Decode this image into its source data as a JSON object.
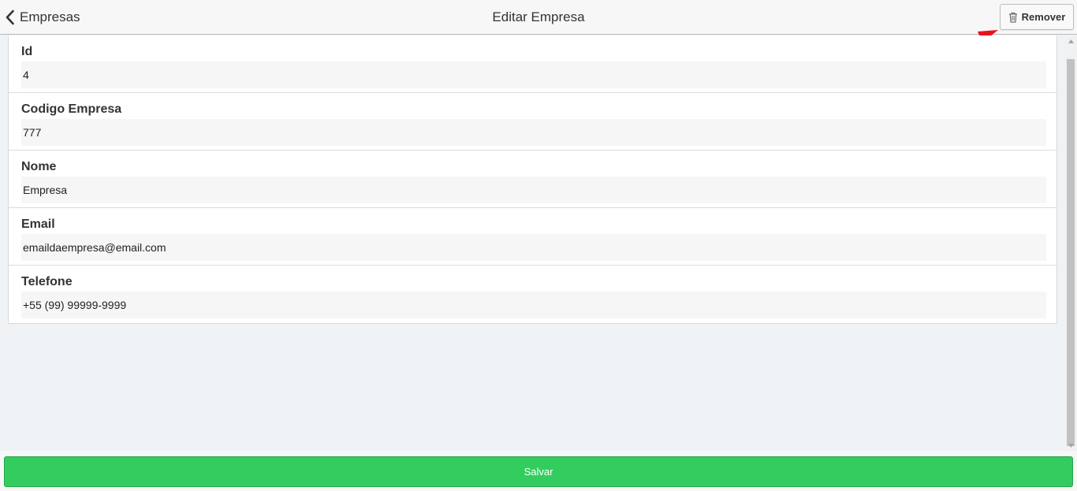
{
  "header": {
    "back_label": "Empresas",
    "title": "Editar Empresa",
    "remove_label": "Remover"
  },
  "form": {
    "fields": [
      {
        "label": "Id",
        "value": "4"
      },
      {
        "label": "Codigo Empresa",
        "value": "777"
      },
      {
        "label": "Nome",
        "value": "Empresa"
      },
      {
        "label": "Email",
        "value": "emaildaempresa@email.com"
      },
      {
        "label": "Telefone",
        "value": "+55 (99) 99999-9999"
      }
    ]
  },
  "footer": {
    "save_label": "Salvar"
  },
  "colors": {
    "primary_button": "#33cd5f",
    "annotation_arrow": "#e8141b"
  },
  "icons": {
    "back": "chevron-left-icon",
    "remove": "trash-icon"
  }
}
